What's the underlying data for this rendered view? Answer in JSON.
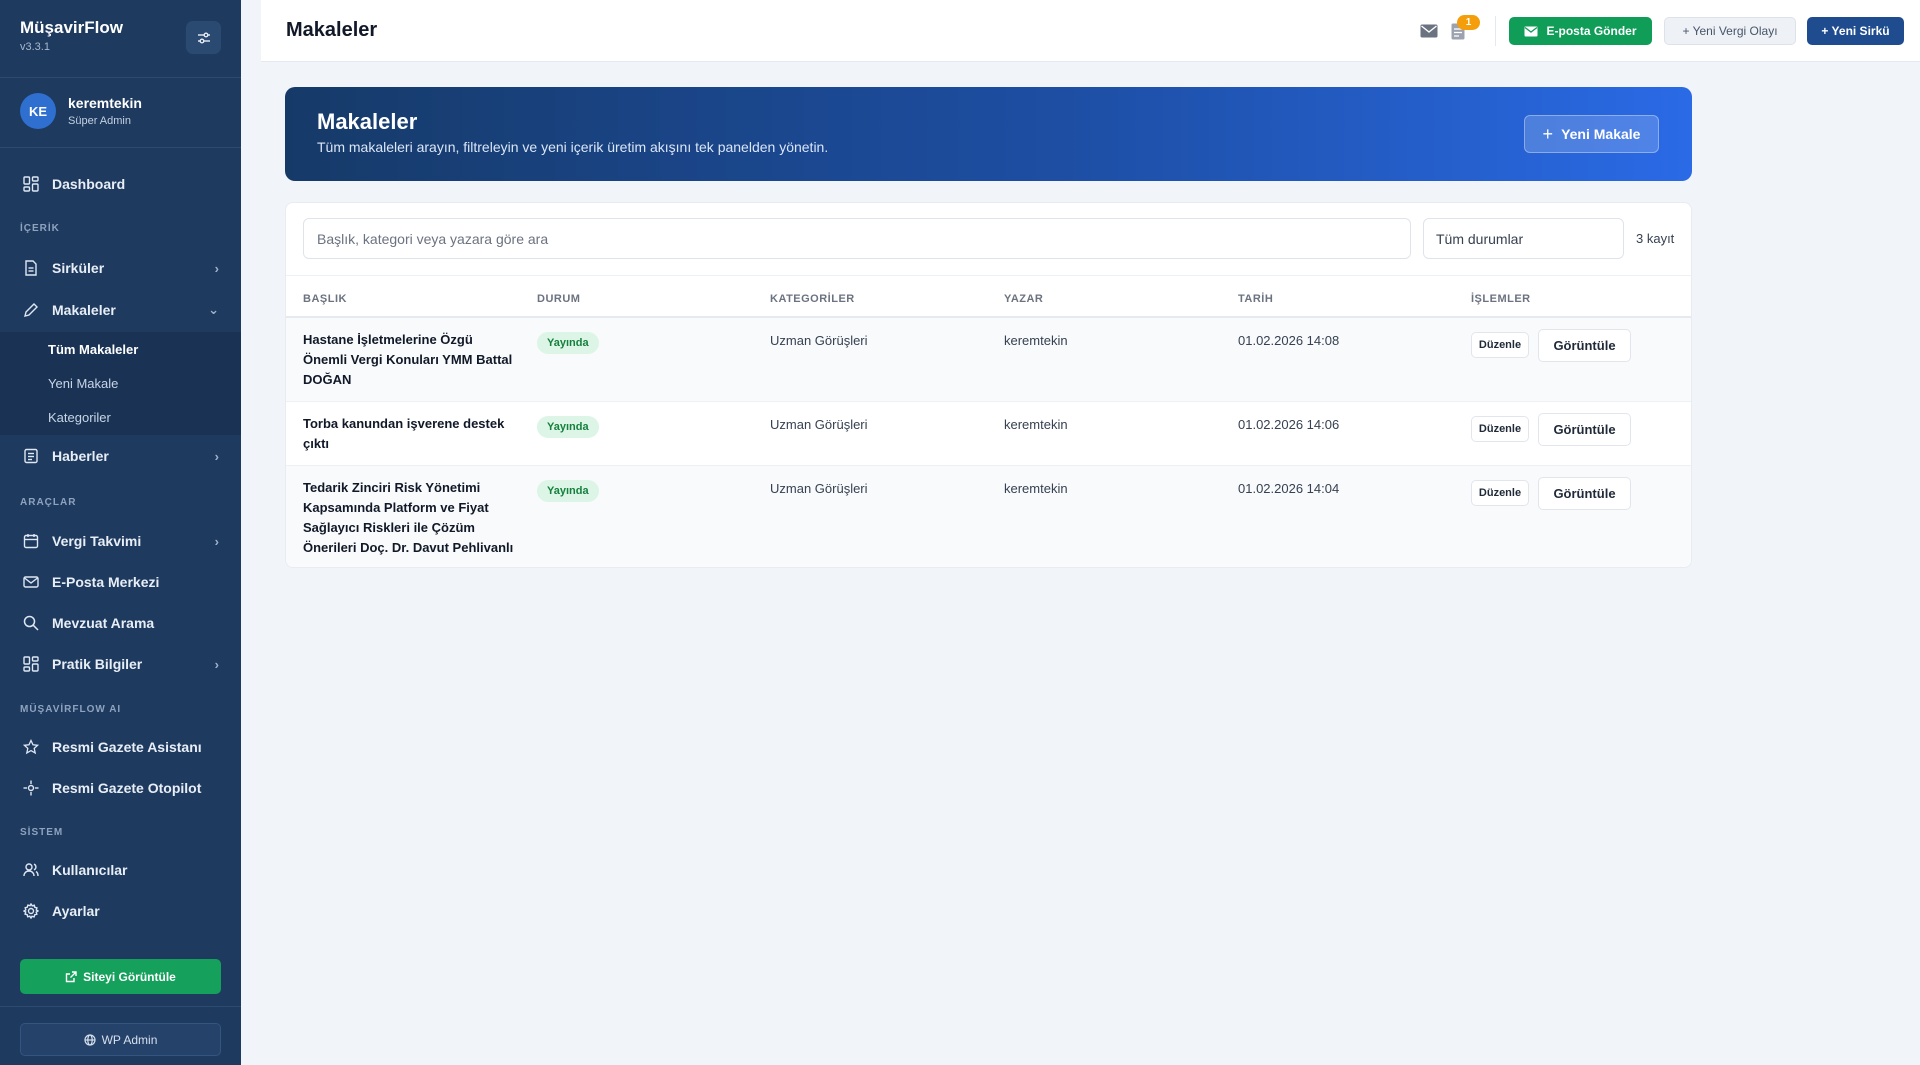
{
  "brand": {
    "name": "MüşavirFlow",
    "version": "v3.3.1"
  },
  "user": {
    "initials": "KE",
    "name": "keremtekin",
    "role": "Süper Admin"
  },
  "nav": {
    "dashboard": "Dashboard",
    "section_content": "İÇERİK",
    "sirkuler": "Sirküler",
    "makaleler": "Makaleler",
    "sub_all": "Tüm Makaleler",
    "sub_new": "Yeni Makale",
    "sub_categories": "Kategoriler",
    "haberler": "Haberler",
    "section_tools": "ARAÇLAR",
    "vergi_takvimi": "Vergi Takvimi",
    "eposta_merkezi": "E-Posta Merkezi",
    "mevzuat_arama": "Mevzuat Arama",
    "pratik_bilgiler": "Pratik Bilgiler",
    "section_ai": "MÜŞAVİRFLOW AI",
    "gazete_asistani": "Resmi Gazete Asistanı",
    "gazete_otopilot": "Resmi Gazete Otopilot",
    "section_system": "SİSTEM",
    "kullanicilar": "Kullanıcılar",
    "ayarlar": "Ayarlar",
    "site_button": "Siteyi Görüntüle",
    "wp_button": "WP Admin"
  },
  "header": {
    "title": "Makaleler",
    "notification_count": "1",
    "email_button": "E-posta Gönder",
    "tax_button": "+ Yeni Vergi Olayı",
    "circular_button": "+ Yeni Sirkü"
  },
  "hero": {
    "title": "Makaleler",
    "subtitle": "Tüm makaleleri arayın, filtreleyin ve yeni içerik üretim akışını tek panelden yönetin.",
    "button": "Yeni Makale"
  },
  "filters": {
    "search_placeholder": "Başlık, kategori veya yazara göre ara",
    "status_selected": "Tüm durumlar",
    "count": "3 kayıt"
  },
  "table": {
    "headers": [
      "BAŞLIK",
      "DURUM",
      "KATEGORİLER",
      "YAZAR",
      "TARİH",
      "İŞLEMLER"
    ],
    "edit_label": "Düzenle",
    "view_label": "Görüntüle",
    "rows": [
      {
        "title": "Hastane İşletmelerine Özgü Önemli Vergi Konuları YMM Battal DOĞAN",
        "status": "Yayında",
        "category": "Uzman Görüşleri",
        "author": "keremtekin",
        "date": "01.02.2026 14:08"
      },
      {
        "title": "Torba kanundan işverene destek çıktı",
        "status": "Yayında",
        "category": "Uzman Görüşleri",
        "author": "keremtekin",
        "date": "01.02.2026 14:06"
      },
      {
        "title": "Tedarik Zinciri Risk Yönetimi Kapsamında Platform ve Fiyat Sağlayıcı Riskleri ile Çözüm Önerileri Doç. Dr. Davut Pehlivanlı",
        "status": "Yayında",
        "category": "Uzman Görüşleri",
        "author": "keremtekin",
        "date": "01.02.2026 14:04"
      }
    ]
  }
}
